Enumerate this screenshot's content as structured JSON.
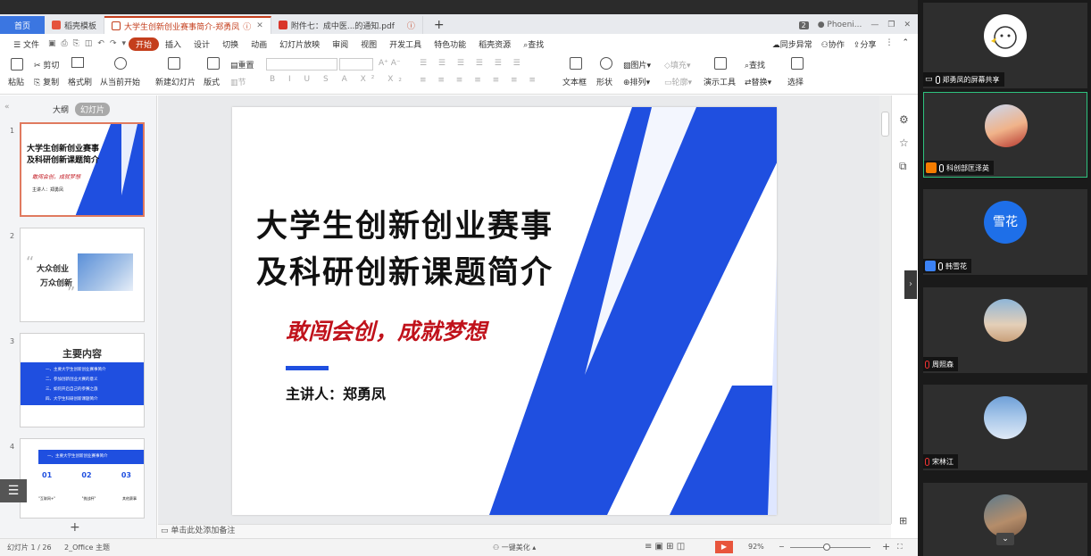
{
  "window": {
    "user": "Phoeni..."
  },
  "tabs": [
    {
      "label": "首页"
    },
    {
      "label": "稻壳模板"
    },
    {
      "label": "大学生创新创业赛事简介-郑勇凤"
    },
    {
      "label": "附件七：成中医...的通知.pdf"
    }
  ],
  "tab_count_badge": "2",
  "menu": {
    "file": "文件",
    "start": "开始",
    "items": [
      "插入",
      "设计",
      "切换",
      "动画",
      "幻灯片放映",
      "审阅",
      "视图",
      "开发工具",
      "特色功能",
      "稻壳资源"
    ],
    "search": "查找",
    "right": [
      "同步异常",
      "协作",
      "分享"
    ]
  },
  "ribbon": {
    "paste": "粘贴",
    "cut": "剪切",
    "copy": "复制",
    "format_painter": "格式刷",
    "from_current": "从当前开始",
    "new_slide": "新建幻灯片",
    "layout": "版式",
    "reset": "重置",
    "section": "节",
    "textbox": "文本框",
    "shape": "形状",
    "picture": "图片",
    "arrange": "排列",
    "fill": "填充",
    "outline": "轮廓",
    "present_tools": "演示工具",
    "find": "查找",
    "replace": "替换",
    "select": "选择"
  },
  "left_panel": {
    "outline": "大纲",
    "slides": "幻灯片",
    "thumbs": [
      {
        "num": "1",
        "title1": "大学生创新创业赛事",
        "title2": "及科研创新课题简介",
        "slogan": "敢闯会创，成就梦想",
        "speaker": "主讲人：郑勇凤"
      },
      {
        "num": "2",
        "line1": "大众创业",
        "line2": "万众创新"
      },
      {
        "num": "3",
        "title": "主要内容",
        "items": [
          "一、主要大学生创新创业赛事简介",
          "二、参加创新创业大赛的意义",
          "三、如何开启自己的参赛之旅",
          "四、大学生科研创新课题简介"
        ]
      },
      {
        "num": "4",
        "header": "一、主要大学生创新创业赛事简介",
        "cols": [
          "01",
          "02",
          "03"
        ],
        "labels": [
          "\"互联网+\"",
          "\"挑战杯\"",
          "其他赛事"
        ]
      }
    ],
    "add": "+"
  },
  "slide": {
    "title1": "大学生创新创业赛事",
    "title2": "及科研创新课题简介",
    "slogan": "敢闯会创，成就梦想",
    "speaker": "主讲人：郑勇凤",
    "colors": {
      "blue": "#1f4fe0",
      "red": "#c0121b"
    }
  },
  "notes_placeholder": "单击此处添加备注",
  "status": {
    "slide_pos": "幻灯片 1 / 26",
    "theme": "2_Office 主题",
    "beautify": "一键美化",
    "zoom": "92%",
    "zoom_fraction": 0.45
  },
  "participants": [
    {
      "name": "郑勇凤的屏幕共享",
      "mic": "on",
      "avatar": "avatar-sketch"
    },
    {
      "name": "科创部匡泽英",
      "mic": "on",
      "avatar": "avatar-photo",
      "active": true
    },
    {
      "name": "韩雪花",
      "mic": "on",
      "avatar_text": "雪花"
    },
    {
      "name": "周照森",
      "mic": "off",
      "avatar": "avatar-anime"
    },
    {
      "name": "宋林江",
      "mic": "off",
      "avatar": "avatar-sky"
    },
    {
      "name": "",
      "mic": "",
      "avatar": "avatar-pic"
    }
  ]
}
